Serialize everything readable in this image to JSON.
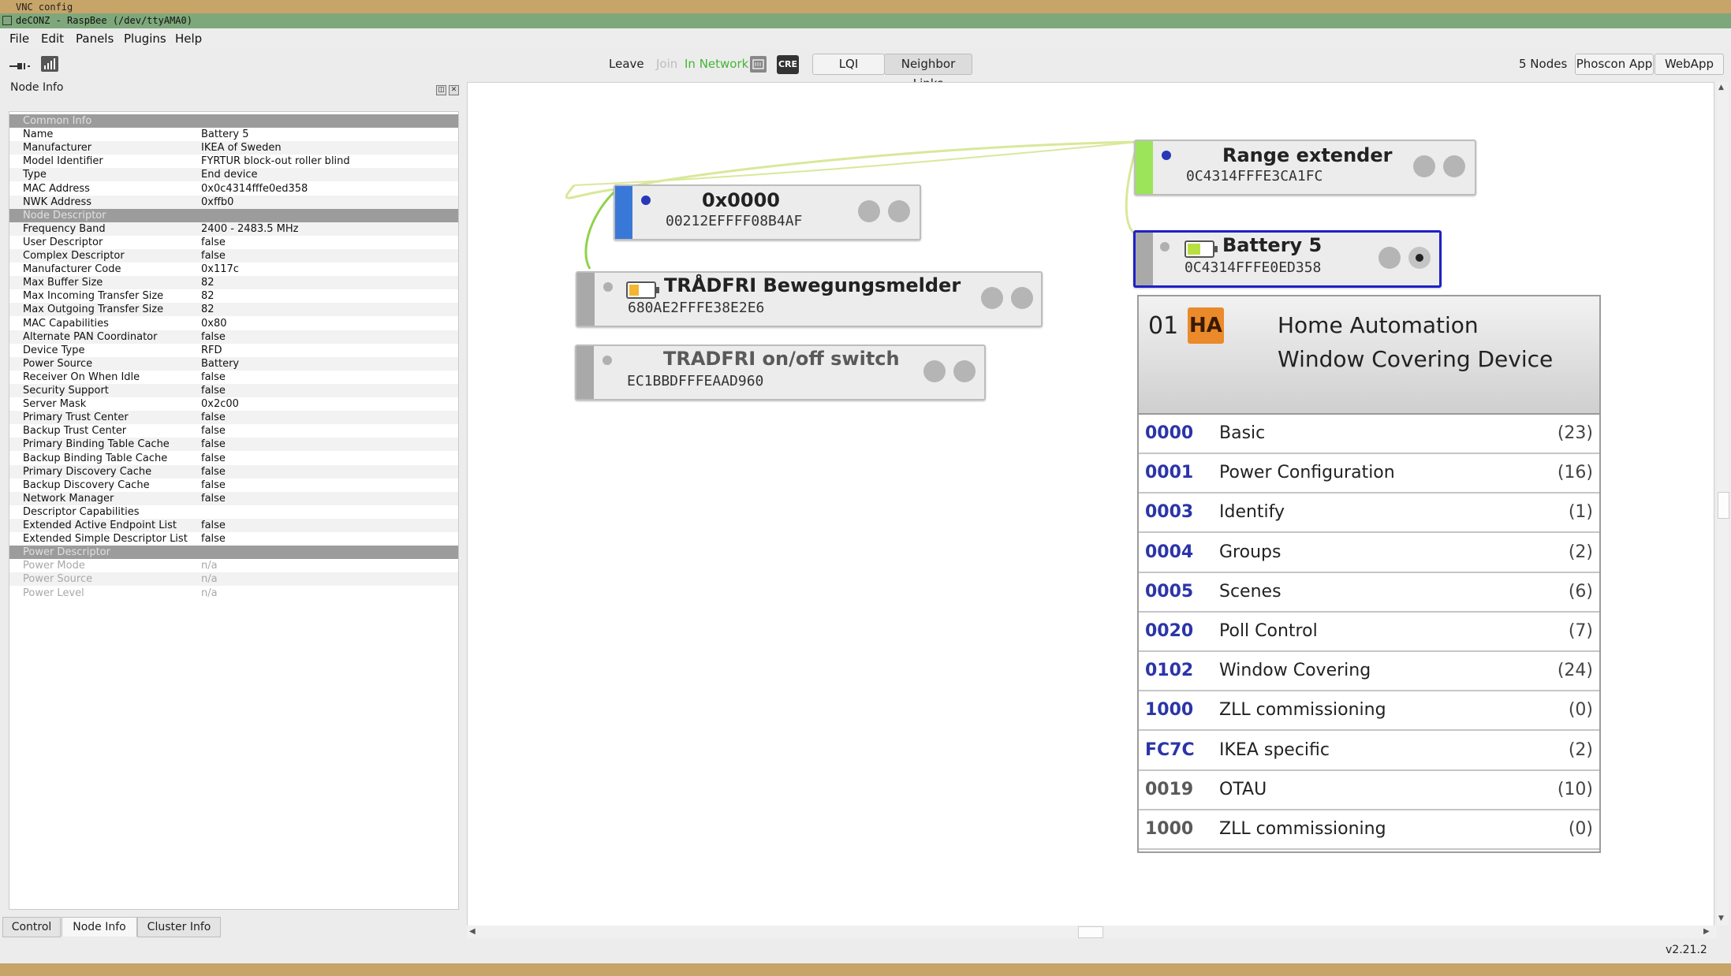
{
  "vnc_title": "VNC config",
  "window_title": "deCONZ - RaspBee (/dev/ttyAMA0)",
  "menu": [
    "File",
    "Edit",
    "Panels",
    "Plugins",
    "Help"
  ],
  "toolbar": {
    "leave": "Leave",
    "join": "Join",
    "in_network": "In Network",
    "cre": "CRE",
    "lqi": "LQI",
    "neighbor_links": "Neighbor Links",
    "nodes_count": "5 Nodes",
    "phoscon_app": "Phoscon App",
    "webapp": "WebApp"
  },
  "node_info": {
    "title": "Node Info",
    "rows": [
      {
        "section": "Common Info"
      },
      {
        "k": "Name",
        "v": "Battery 5"
      },
      {
        "k": "Manufacturer",
        "v": "IKEA of Sweden"
      },
      {
        "k": "Model Identifier",
        "v": "FYRTUR block-out roller blind"
      },
      {
        "k": "Type",
        "v": "End device"
      },
      {
        "k": "MAC Address",
        "v": "0x0c4314fffe0ed358"
      },
      {
        "k": "NWK Address",
        "v": "0xffb0"
      },
      {
        "section": "Node Descriptor"
      },
      {
        "k": "Frequency Band",
        "v": "2400 - 2483.5 MHz"
      },
      {
        "k": "User Descriptor",
        "v": "false"
      },
      {
        "k": "Complex Descriptor",
        "v": "false"
      },
      {
        "k": "Manufacturer Code",
        "v": "0x117c"
      },
      {
        "k": "Max Buffer Size",
        "v": "82"
      },
      {
        "k": "Max Incoming Transfer Size",
        "v": "82"
      },
      {
        "k": "Max Outgoing Transfer Size",
        "v": "82"
      },
      {
        "k": "MAC Capabilities",
        "v": "0x80"
      },
      {
        "k": "Alternate PAN Coordinator",
        "v": "false"
      },
      {
        "k": "Device Type",
        "v": "RFD"
      },
      {
        "k": "Power Source",
        "v": "Battery"
      },
      {
        "k": "Receiver On When Idle",
        "v": "false"
      },
      {
        "k": "Security Support",
        "v": "false"
      },
      {
        "k": "Server Mask",
        "v": "0x2c00"
      },
      {
        "k": "Primary Trust Center",
        "v": "false"
      },
      {
        "k": "Backup Trust Center",
        "v": "false"
      },
      {
        "k": "Primary Binding Table Cache",
        "v": "false"
      },
      {
        "k": "Backup Binding Table Cache",
        "v": "false"
      },
      {
        "k": "Primary Discovery Cache",
        "v": "false"
      },
      {
        "k": "Backup Discovery Cache",
        "v": "false"
      },
      {
        "k": "Network Manager",
        "v": "false"
      },
      {
        "k": "Descriptor Capabilities",
        "v": ""
      },
      {
        "k": "Extended Active Endpoint List",
        "v": "false"
      },
      {
        "k": "Extended Simple Descriptor List",
        "v": "false"
      },
      {
        "section": "Power Descriptor"
      },
      {
        "k": "Power Mode",
        "v": "n/a",
        "dim": true
      },
      {
        "k": "Power Source",
        "v": "n/a",
        "dim": true
      },
      {
        "k": "Power Level",
        "v": "n/a",
        "dim": true
      }
    ]
  },
  "bottom_tabs": [
    "Control",
    "Node Info",
    "Cluster Info"
  ],
  "nodes": {
    "coordinator": {
      "name": "0x0000",
      "mac": "00212EFFFF08B4AF"
    },
    "range_extender": {
      "name": "Range extender",
      "mac": "0C4314FFFE3CA1FC"
    },
    "battery5": {
      "name": "Battery 5",
      "mac": "0C4314FFFE0ED358"
    },
    "motion": {
      "name": "TRÅDFRI Bewegungsmelder",
      "mac": "680AE2FFFE38E2E6"
    },
    "switch": {
      "name": "TRADFRI on/off switch",
      "mac": "EC1BBDFFFEAAD960"
    }
  },
  "endpoint": {
    "number": "01",
    "profile_badge": "HA",
    "profile": "Home Automation",
    "device": "Window Covering Device",
    "clusters": [
      {
        "id": "0000",
        "name": "Basic",
        "count": "(23)",
        "out": false
      },
      {
        "id": "0001",
        "name": "Power Configuration",
        "count": "(16)",
        "out": false
      },
      {
        "id": "0003",
        "name": "Identify",
        "count": "(1)",
        "out": false
      },
      {
        "id": "0004",
        "name": "Groups",
        "count": "(2)",
        "out": false
      },
      {
        "id": "0005",
        "name": "Scenes",
        "count": "(6)",
        "out": false
      },
      {
        "id": "0020",
        "name": "Poll Control",
        "count": "(7)",
        "out": false
      },
      {
        "id": "0102",
        "name": "Window Covering",
        "count": "(24)",
        "out": false
      },
      {
        "id": "1000",
        "name": "ZLL commissioning",
        "count": "(0)",
        "out": false
      },
      {
        "id": "FC7C",
        "name": "IKEA specific",
        "count": "(2)",
        "out": false
      },
      {
        "id": "0019",
        "name": "OTAU",
        "count": "(10)",
        "out": true
      },
      {
        "id": "1000",
        "name": "ZLL commissioning",
        "count": "(0)",
        "out": true
      }
    ]
  },
  "version": "v2.21.2",
  "colors": {
    "cluster_in": "#2b35a8",
    "in_network": "#44b535",
    "selected_border": "#2020c8"
  }
}
